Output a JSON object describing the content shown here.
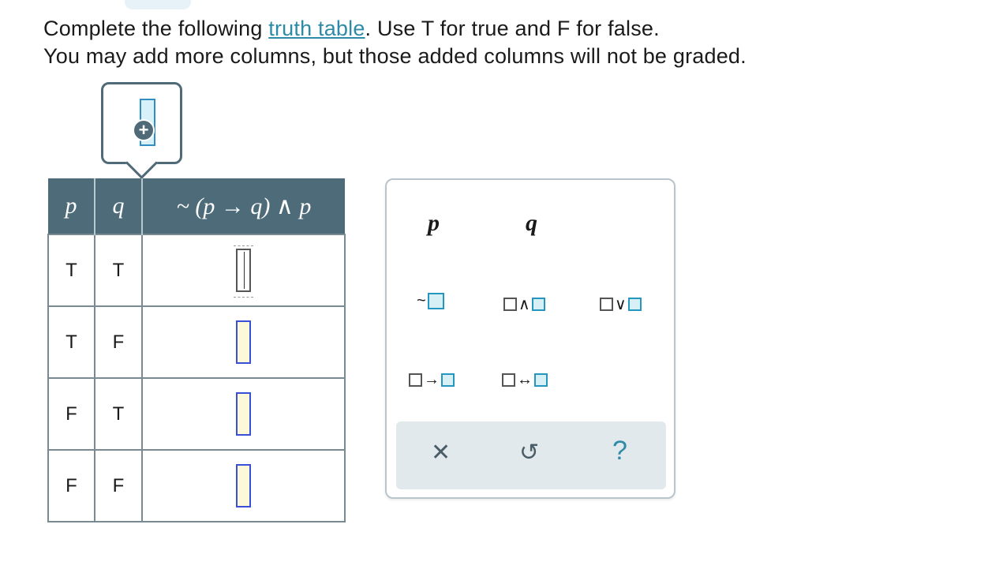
{
  "instructions": {
    "line1_prefix": "Complete the following ",
    "link_text": "truth table",
    "line1_suffix": ". Use T for true and F for false.",
    "line2": "You may add more columns, but those added columns will not be graded."
  },
  "add_column": {
    "plus_symbol": "+"
  },
  "table": {
    "headers": [
      "p",
      "q",
      "~ (p → q) ∧ p"
    ],
    "rows": [
      {
        "p": "T",
        "q": "T"
      },
      {
        "p": "T",
        "q": "F"
      },
      {
        "p": "F",
        "q": "T"
      },
      {
        "p": "F",
        "q": "F"
      }
    ]
  },
  "keypad": {
    "var_p": "p",
    "var_q": "q",
    "not_symbol": "~",
    "and_symbol": "∧",
    "or_symbol": "∨",
    "implies_symbol": "→",
    "iff_symbol": "↔",
    "clear_symbol": "✕",
    "undo_symbol": "↺",
    "help_symbol": "?"
  }
}
